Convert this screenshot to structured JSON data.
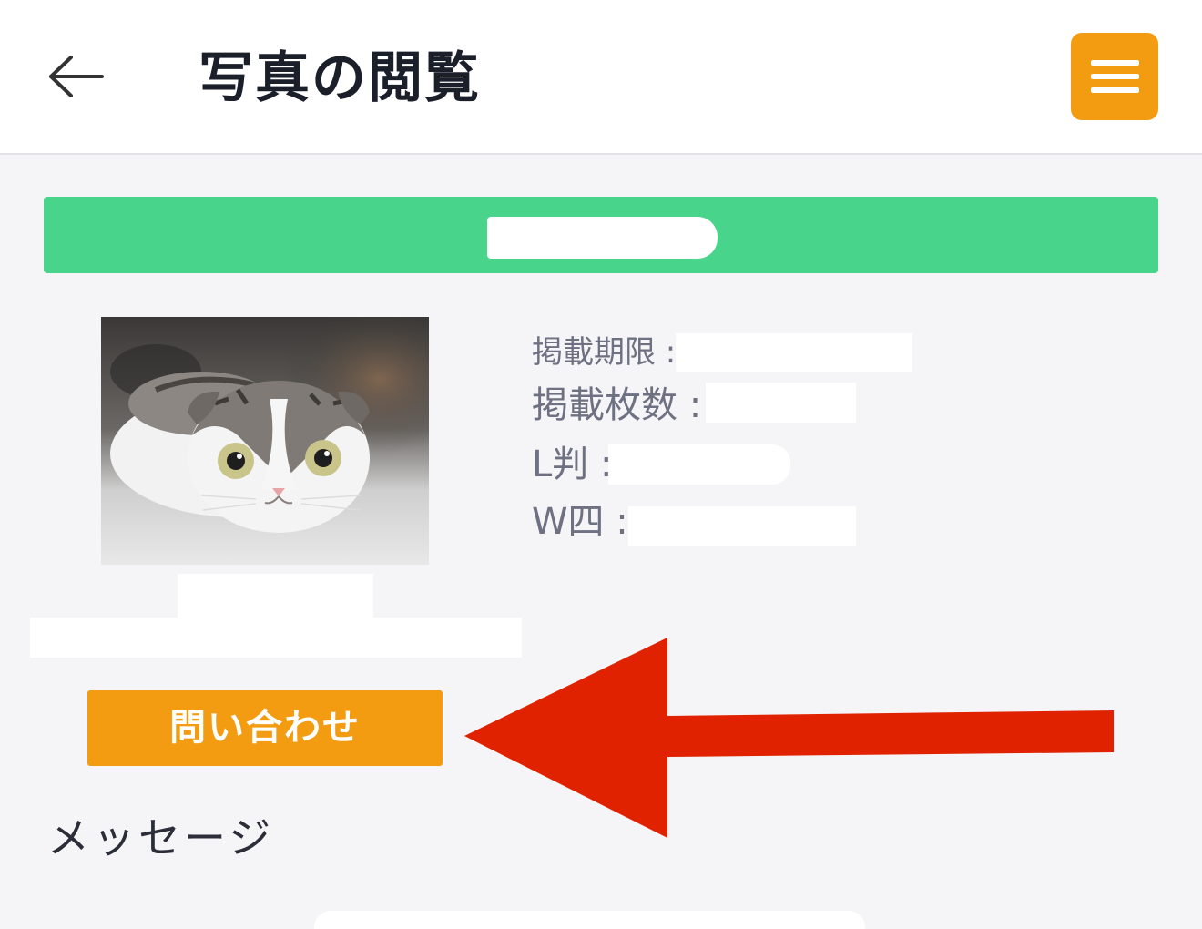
{
  "header": {
    "back_icon": "arrow-left-icon",
    "title": "写真の閲覧",
    "menu_icon": "hamburger-menu-icon",
    "accent_color": "#f39c12"
  },
  "banner": {
    "color": "#48d48a"
  },
  "photo": {
    "subject": "cat"
  },
  "info": {
    "deadline_label": "掲載期限 :",
    "count_label": "掲載枚数 :",
    "l_size_label": "L判 :",
    "w4_label": "W四 :"
  },
  "contact_button": {
    "label": "問い合わせ",
    "color": "#f39c12"
  },
  "messages": {
    "heading": "メッセージ"
  },
  "annotation": {
    "arrow_color": "#e02200"
  }
}
